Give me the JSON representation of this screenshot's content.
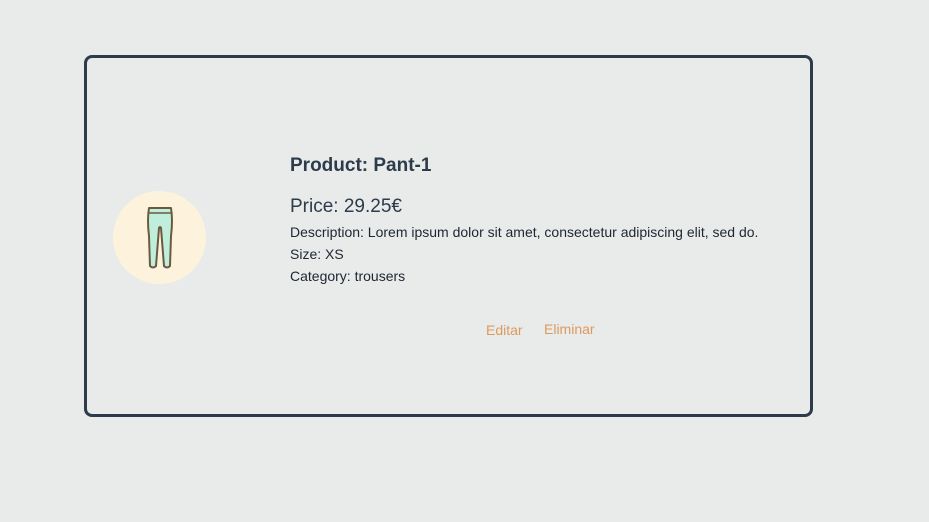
{
  "product": {
    "title": "Product: Pant-1",
    "price": "Price: 29.25€",
    "description": "Description: Lorem ipsum dolor sit amet, consectetur adipiscing elit, sed do.",
    "size": "Size: XS",
    "category": "Category: trousers",
    "icon": "pants-icon"
  },
  "actions": {
    "edit_label": "Editar",
    "delete_label": "Eliminar"
  },
  "colors": {
    "background": "#e8ebea",
    "border": "#2d3b4a",
    "avatar_bg": "#fdf3dc",
    "pants_fill": "#bfeedd",
    "pants_outline": "#6b5a3e",
    "action": "#dd9a5c",
    "title": "#2d3b4a"
  }
}
